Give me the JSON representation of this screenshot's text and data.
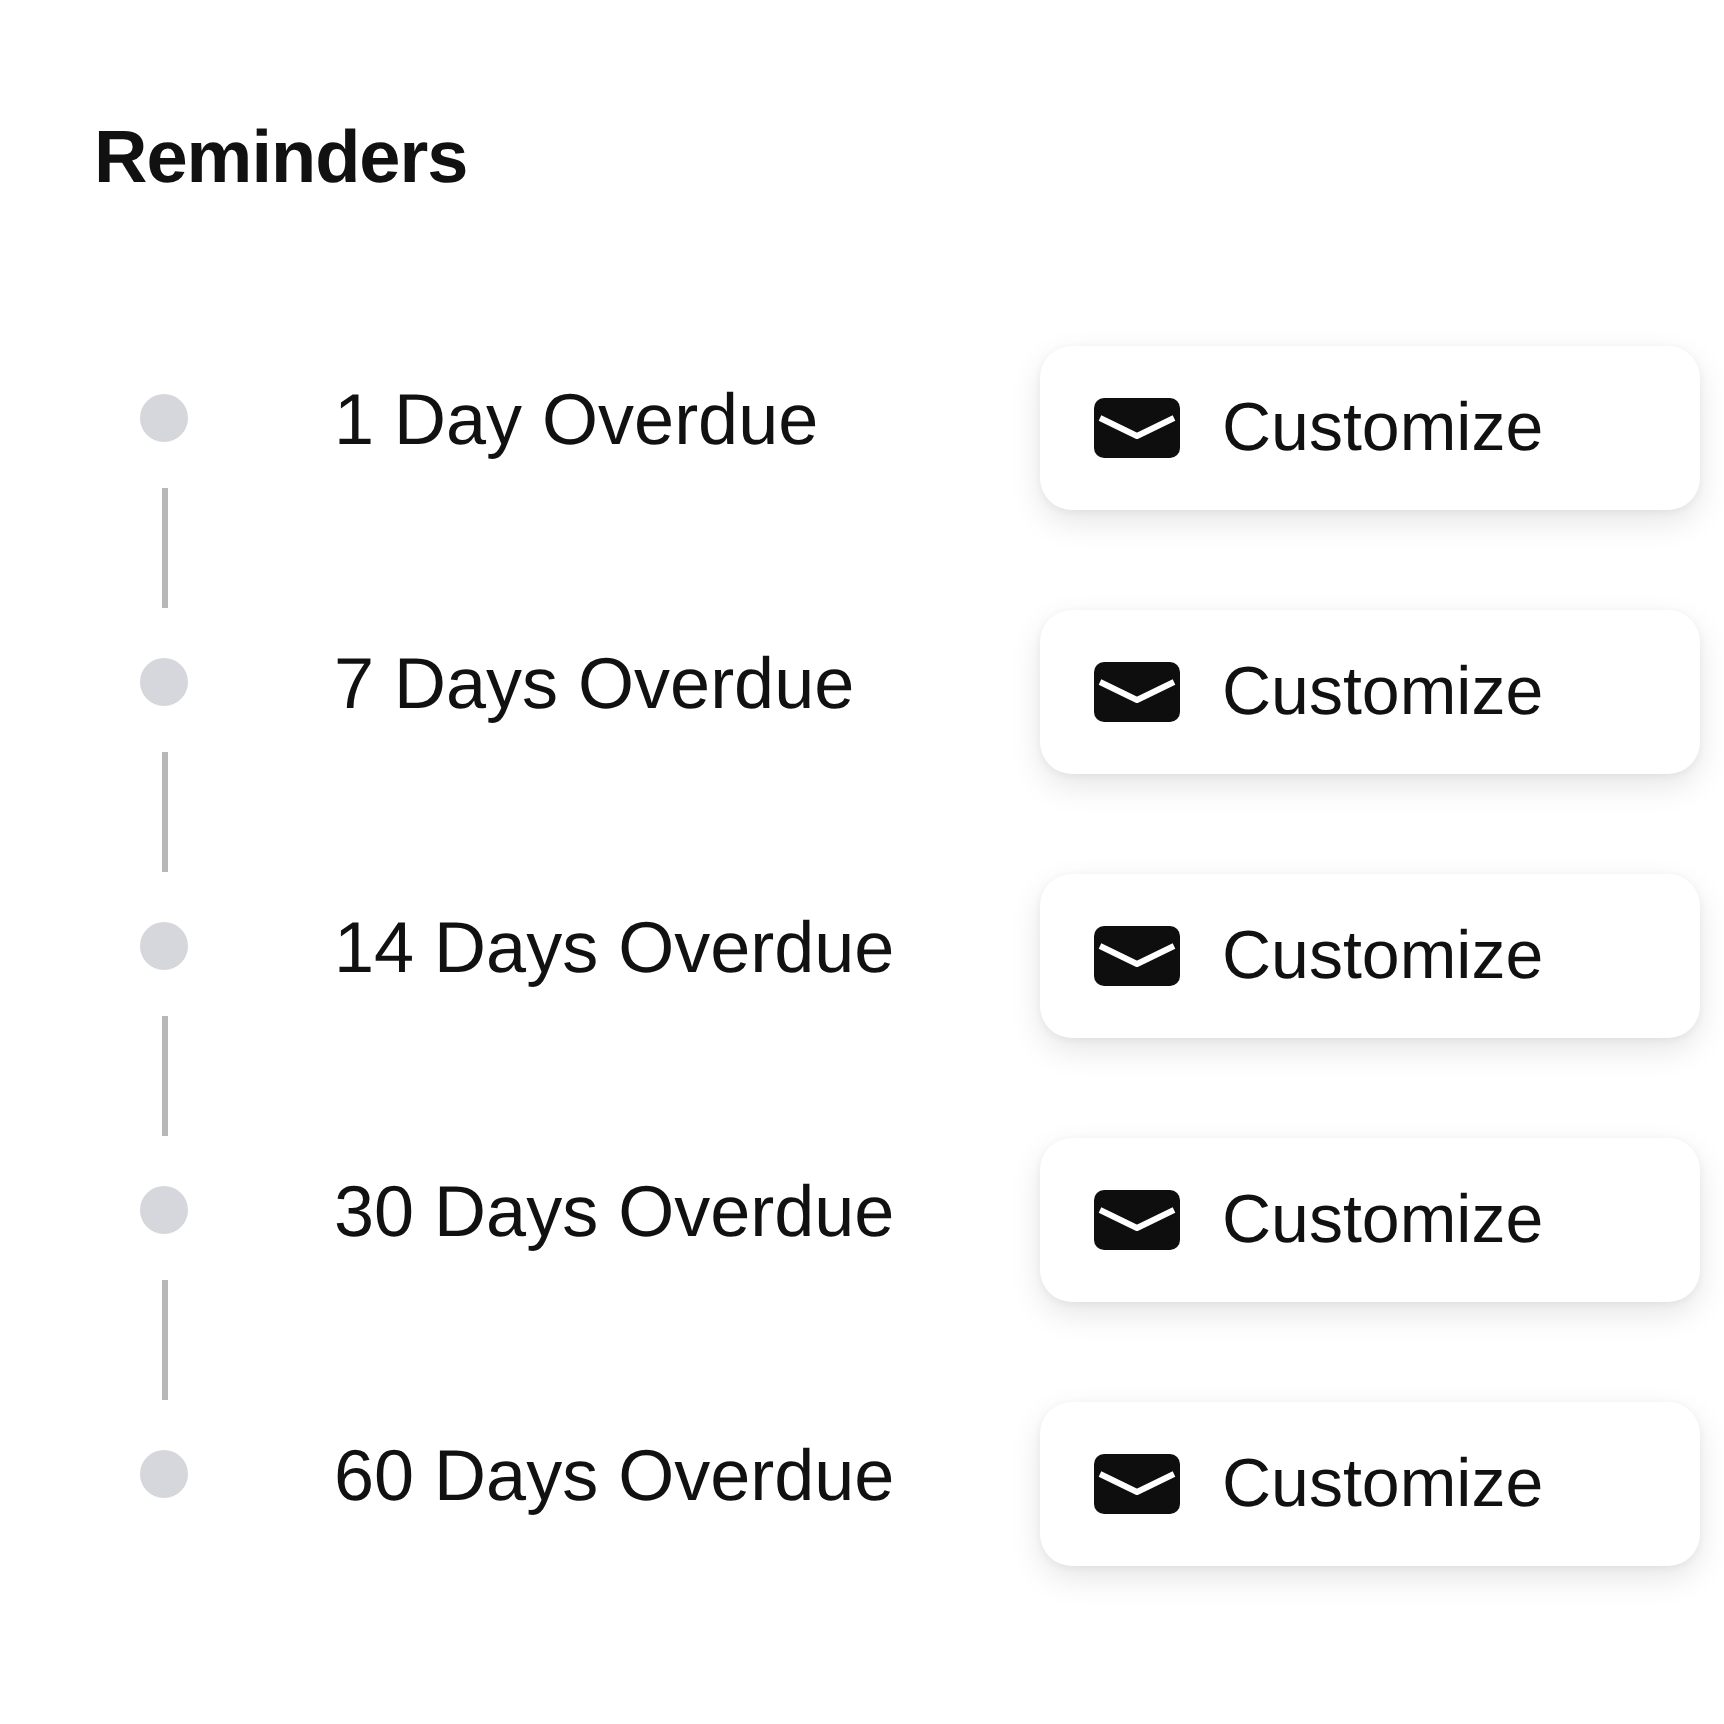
{
  "title": "Reminders",
  "reminders": [
    {
      "label": "1 Day Overdue",
      "button": "Customize"
    },
    {
      "label": "7 Days Overdue",
      "button": "Customize"
    },
    {
      "label": "14 Days Overdue",
      "button": "Customize"
    },
    {
      "label": "30 Days Overdue",
      "button": "Customize"
    },
    {
      "label": "60 Days Overdue",
      "button": "Customize"
    }
  ]
}
